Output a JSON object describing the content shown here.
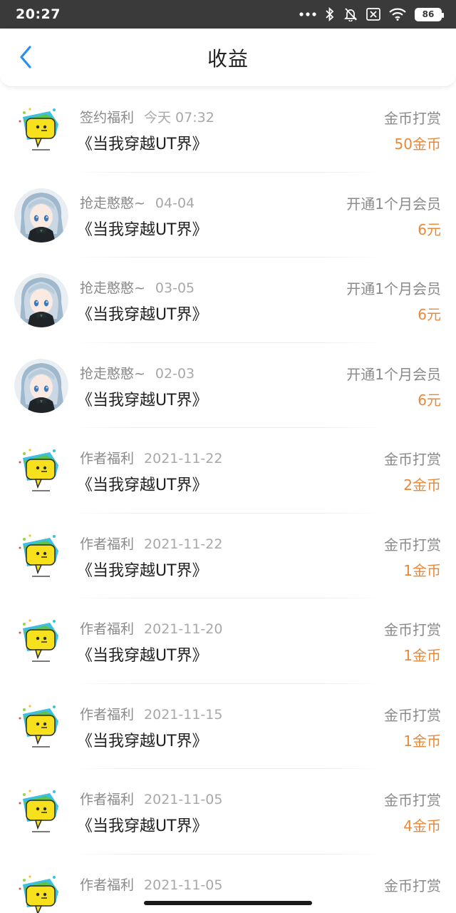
{
  "status_bar": {
    "time": "20:27",
    "battery": "86",
    "icons": [
      "more-dots-icon",
      "bluetooth-icon",
      "mute-bell-icon",
      "sim-none-icon",
      "wifi-icon",
      "battery-icon"
    ]
  },
  "header": {
    "title": "收益",
    "back_icon": "chevron-left-icon",
    "accent": "#2b8ff0"
  },
  "colors": {
    "amount": "#e8883a",
    "meta": "#8a8a8a"
  },
  "rows": [
    {
      "avatar": "speech-bubble-logo",
      "source": "签约福利",
      "date": "今天 07:32",
      "book": "《当我穿越UT界》",
      "type": "金币打赏",
      "amount": "50金币"
    },
    {
      "avatar": "anime-girl",
      "source": "抢走憨憨~",
      "date": "04-04",
      "book": "《当我穿越UT界》",
      "type": "开通1个月会员",
      "amount": "6元"
    },
    {
      "avatar": "anime-girl",
      "source": "抢走憨憨~",
      "date": "03-05",
      "book": "《当我穿越UT界》",
      "type": "开通1个月会员",
      "amount": "6元"
    },
    {
      "avatar": "anime-girl",
      "source": "抢走憨憨~",
      "date": "02-03",
      "book": "《当我穿越UT界》",
      "type": "开通1个月会员",
      "amount": "6元"
    },
    {
      "avatar": "speech-bubble-logo",
      "source": "作者福利",
      "date": "2021-11-22",
      "book": "《当我穿越UT界》",
      "type": "金币打赏",
      "amount": "2金币"
    },
    {
      "avatar": "speech-bubble-logo",
      "source": "作者福利",
      "date": "2021-11-22",
      "book": "《当我穿越UT界》",
      "type": "金币打赏",
      "amount": "1金币"
    },
    {
      "avatar": "speech-bubble-logo",
      "source": "作者福利",
      "date": "2021-11-20",
      "book": "《当我穿越UT界》",
      "type": "金币打赏",
      "amount": "1金币"
    },
    {
      "avatar": "speech-bubble-logo",
      "source": "作者福利",
      "date": "2021-11-15",
      "book": "《当我穿越UT界》",
      "type": "金币打赏",
      "amount": "1金币"
    },
    {
      "avatar": "speech-bubble-logo",
      "source": "作者福利",
      "date": "2021-11-05",
      "book": "《当我穿越UT界》",
      "type": "金币打赏",
      "amount": "4金币"
    },
    {
      "avatar": "speech-bubble-logo",
      "source": "作者福利",
      "date": "2021-11-05",
      "book": "",
      "type": "金币打赏",
      "amount": ""
    }
  ]
}
